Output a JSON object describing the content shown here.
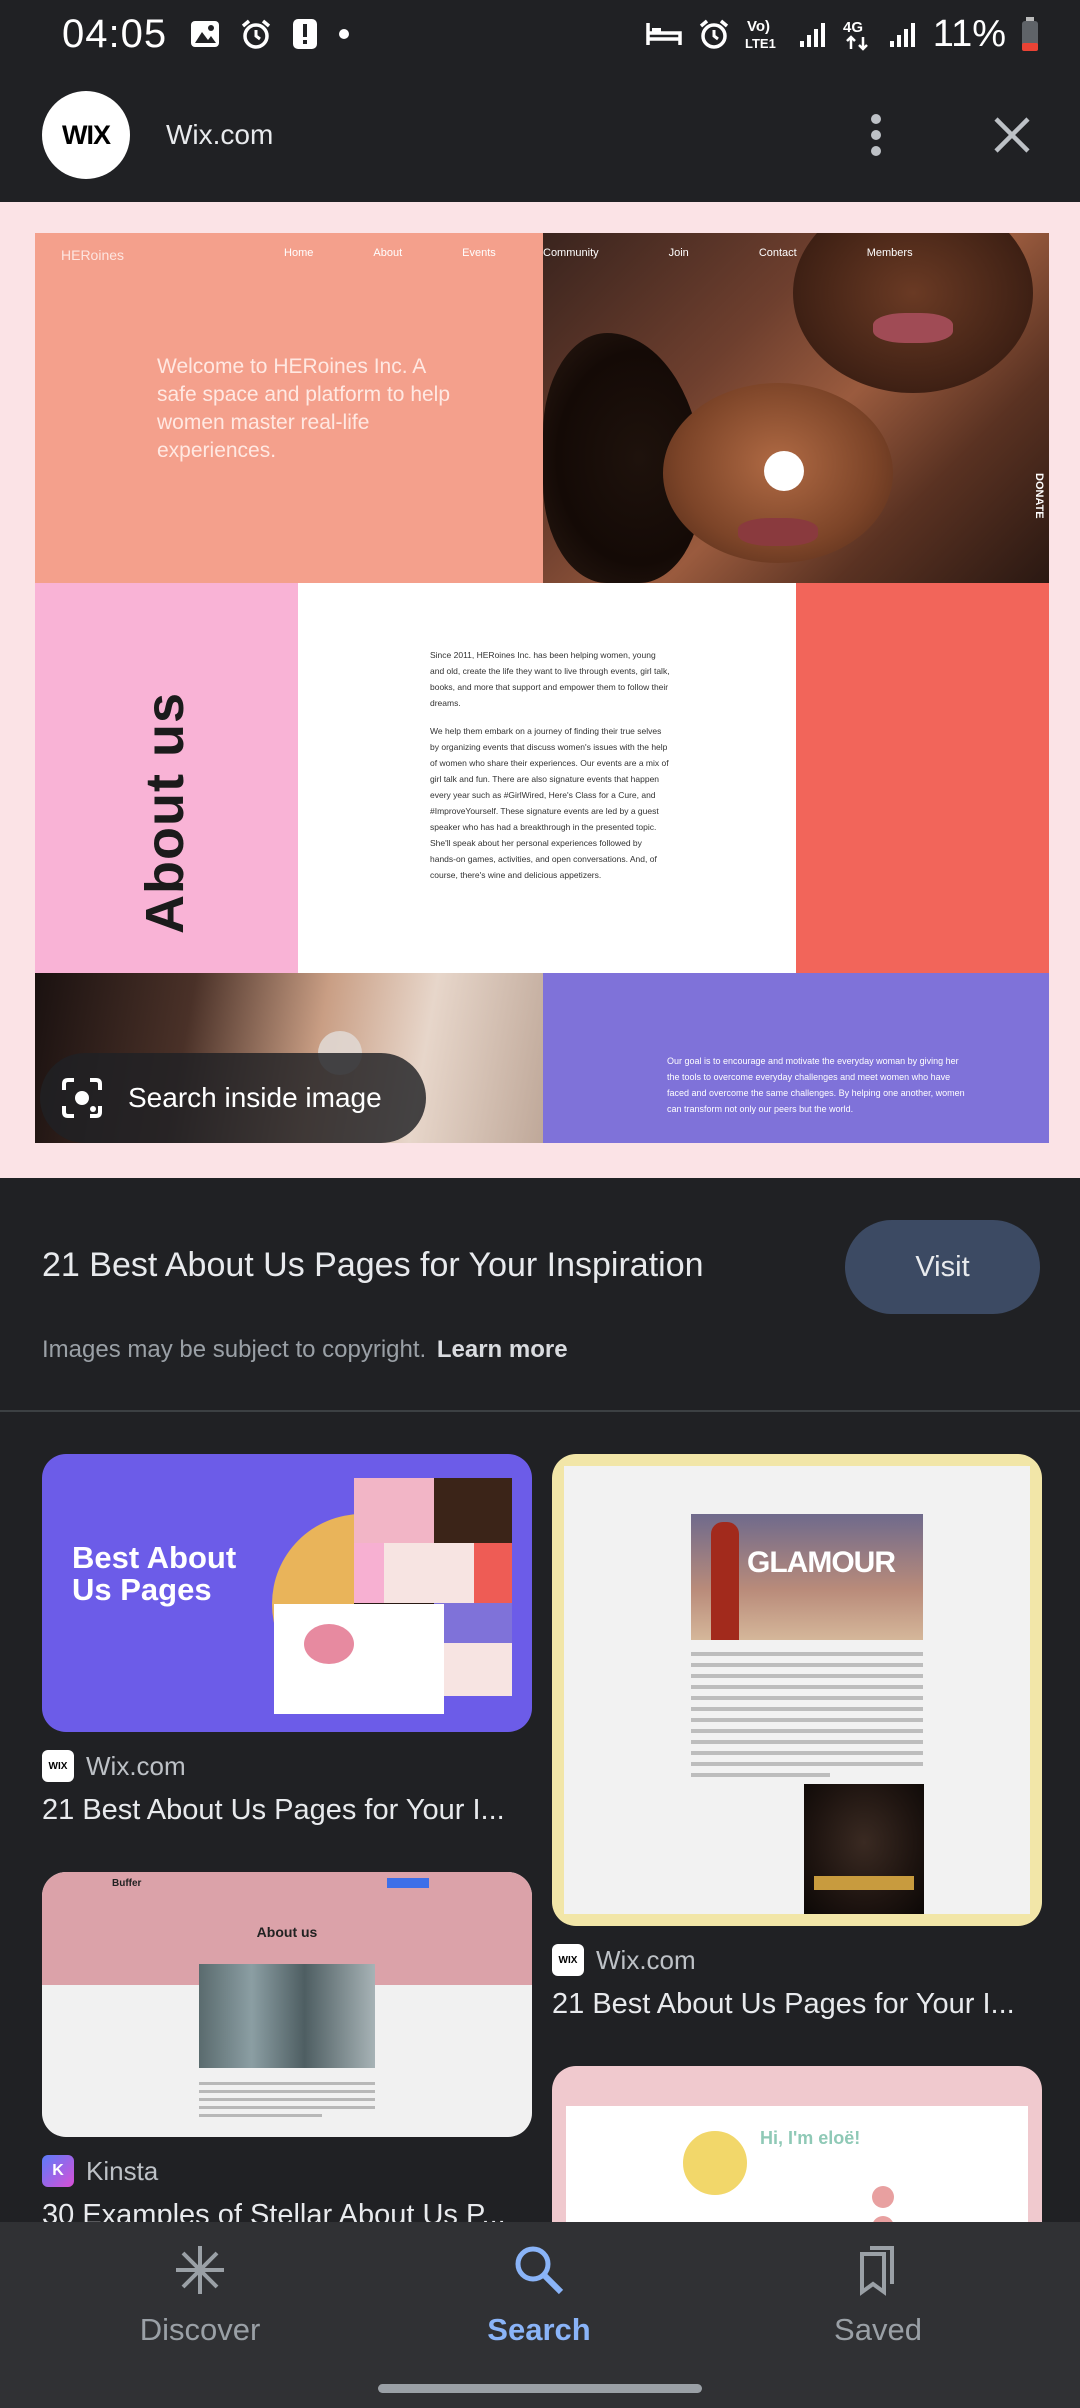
{
  "status_bar": {
    "time": "04:05",
    "battery": "11%",
    "network": "4G",
    "volte": "Vo) LTE1"
  },
  "header": {
    "logo_text": "WIX",
    "site_name": "Wix.com"
  },
  "preview": {
    "nav": [
      "HERoines",
      "Home",
      "About",
      "Events",
      "Community",
      "Join",
      "Contact",
      "Members"
    ],
    "hero_text": "Welcome to HERoines Inc. A safe space and platform to help women master real-life experiences.",
    "donate": "DONATE",
    "about_title": "About us",
    "about_p1": "Since 2011, HERoines Inc. has been helping women, young and old, create the life they want to live through events, girl talk, books, and more that support and empower them to follow their dreams.",
    "about_p2": "We help them embark on a journey of finding their true selves by organizing events that discuss women's issues with the help of women who share their experiences. Our events are a mix of girl talk and fun. There are also signature events that happen every year such as #GirlWired, Here's Class for a Cure, and #ImproveYourself. These signature events are led by a guest speaker who has had a breakthrough in the presented topic. She'll speak about her personal experiences followed by hands-on games, activities, and open conversations. And, of course, there's wine and delicious appetizers.",
    "purple_text": "Our goal is to encourage and motivate the everyday woman by giving her the tools to overcome everyday challenges and meet women who have faced and overcome the same challenges. By helping one another, women can transform not only our peers but the world.",
    "search_inside_label": "Search inside image"
  },
  "result": {
    "title": "21 Best About Us Pages for Your Inspiration",
    "visit_label": "Visit",
    "copyright_text": "Images may be subject to copyright.",
    "learn_more": "Learn more"
  },
  "grid": {
    "cards": [
      {
        "thumb_text": "Best About Us Pages",
        "source": "Wix.com",
        "source_icon": "WIX",
        "title": "21 Best About Us Pages for Your I..."
      },
      {
        "thumb_text": "GLAMOUR",
        "source": "Wix.com",
        "source_icon": "WIX",
        "title": "21 Best About Us Pages for Your I..."
      },
      {
        "thumb_text": "About us",
        "thumb_logo": "Buffer",
        "source": "Kinsta",
        "source_icon": "K",
        "title": "30 Examples of Stellar About Us P..."
      },
      {
        "thumb_text": "Hi, I'm eloë!"
      }
    ]
  },
  "bottom_nav": {
    "items": [
      {
        "label": "Discover",
        "icon": "asterisk-icon",
        "active": false
      },
      {
        "label": "Search",
        "icon": "search-icon",
        "active": true
      },
      {
        "label": "Saved",
        "icon": "bookmarks-icon",
        "active": false
      }
    ],
    "active_color": "#8ab4f8",
    "inactive_color": "#9aa0a6"
  }
}
